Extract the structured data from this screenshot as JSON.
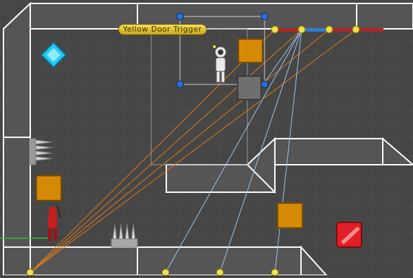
{
  "scene": {
    "trigger_label": "Yellow Door Trigger",
    "colors": {
      "background": "#464646",
      "grid": "#4e4e4e",
      "wall_fill": "#555555",
      "wall_outline": "#ffffff",
      "orange_link": "#e07b18",
      "blue_link": "#9ec8ec",
      "node": "#f2e04a",
      "handle": "#2a6fd6",
      "crate": "#d58a06",
      "red_gem": "#e21f27",
      "blue_gem": "#28c8f2",
      "player": "#e9e9e9",
      "enemy": "#c41e1e"
    },
    "icons": [
      "blue-diamond-gem",
      "red-square-gem",
      "astronaut-player",
      "red-ninja-enemy",
      "spike-trap",
      "crate"
    ]
  }
}
